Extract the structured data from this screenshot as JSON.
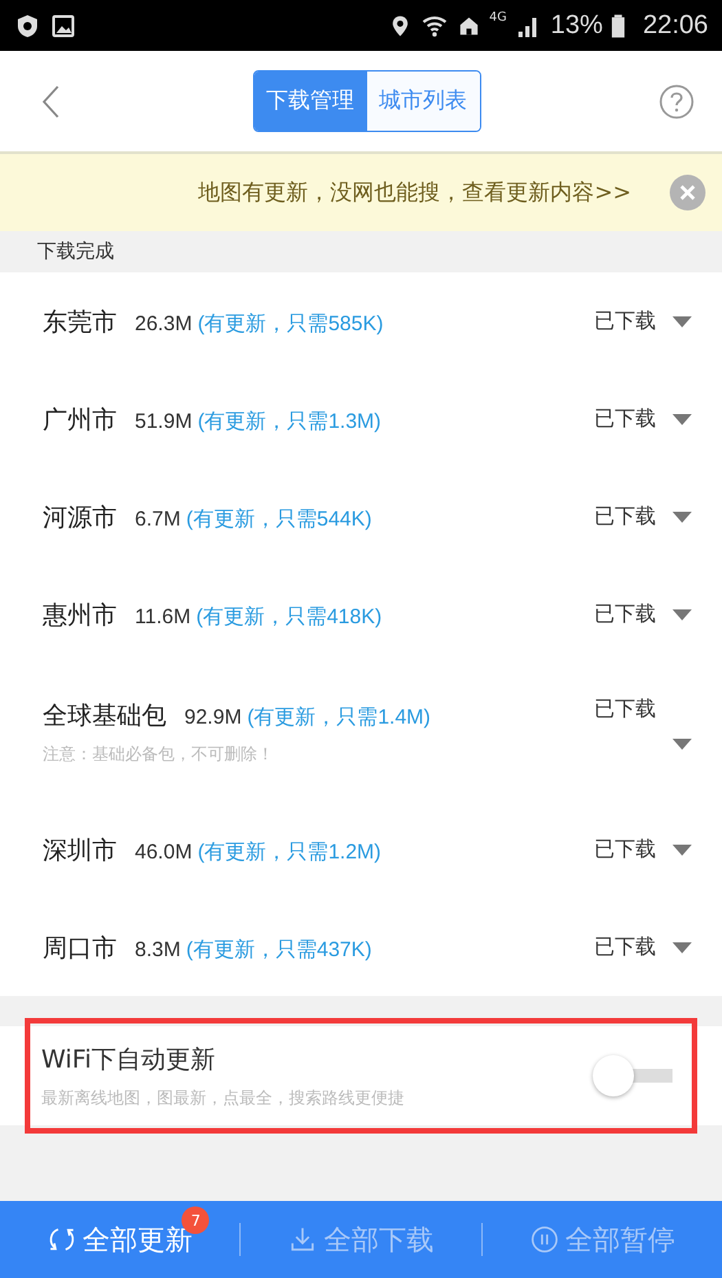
{
  "status_bar": {
    "battery": "13%",
    "network": "4G",
    "time": "22:06"
  },
  "header": {
    "tabs": [
      {
        "label": "下载管理",
        "selected": true
      },
      {
        "label": "城市列表",
        "selected": false
      }
    ]
  },
  "banner": {
    "text": "地图有更新，没网也能搜，查看更新内容>>"
  },
  "section_title": "下载完成",
  "cities": [
    {
      "name": "东莞市",
      "size": "26.3M",
      "update": "(有更新，只需585K)",
      "status": "已下载"
    },
    {
      "name": "广州市",
      "size": "51.9M",
      "update": "(有更新，只需1.3M)",
      "status": "已下载"
    },
    {
      "name": "河源市",
      "size": "6.7M",
      "update": "(有更新，只需544K)",
      "status": "已下载"
    },
    {
      "name": "惠州市",
      "size": "11.6M",
      "update": "(有更新，只需418K)",
      "status": "已下载"
    },
    {
      "name": "全球基础包",
      "size": "92.9M",
      "update": "(有更新，只需1.4M)",
      "status": "已下载",
      "note": "注意：基础必备包，不可删除！"
    },
    {
      "name": "深圳市",
      "size": "46.0M",
      "update": "(有更新，只需1.2M)",
      "status": "已下载"
    },
    {
      "name": "周口市",
      "size": "8.3M",
      "update": "(有更新，只需437K)",
      "status": "已下载"
    }
  ],
  "wifi_setting": {
    "title": "WiFi下自动更新",
    "description": "最新离线地图，图最新，点最全，搜索路线更便捷",
    "on": false,
    "highlighted": true
  },
  "bottom_bar": [
    {
      "kind": "update",
      "label": "全部更新",
      "badge": "7",
      "disabled": false
    },
    {
      "kind": "download",
      "label": "全部下载",
      "disabled": true
    },
    {
      "kind": "pause",
      "label": "全部暂停",
      "disabled": true
    }
  ]
}
